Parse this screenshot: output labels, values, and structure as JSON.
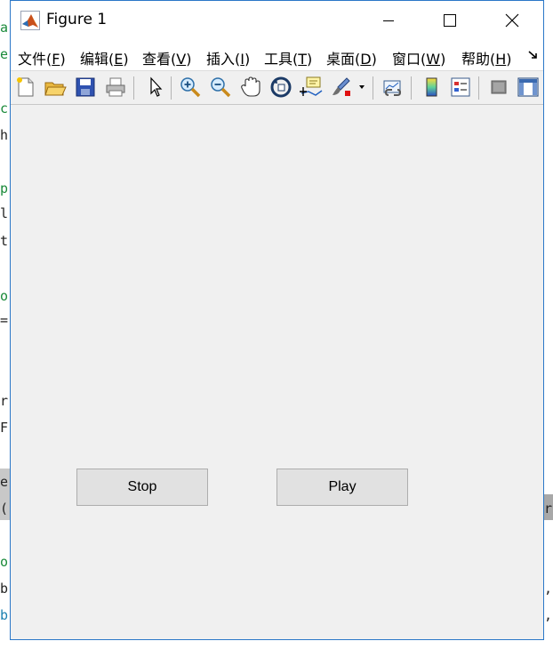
{
  "window": {
    "title": "Figure 1"
  },
  "menu": [
    {
      "text": "文件(",
      "key": "F",
      "tail": ")"
    },
    {
      "text": "编辑(",
      "key": "E",
      "tail": ")"
    },
    {
      "text": "查看(",
      "key": "V",
      "tail": ")"
    },
    {
      "text": "插入(",
      "key": "I",
      "tail": ")"
    },
    {
      "text": "工具(",
      "key": "T",
      "tail": ")"
    },
    {
      "text": "桌面(",
      "key": "D",
      "tail": ")"
    },
    {
      "text": "窗口(",
      "key": "W",
      "tail": ")"
    },
    {
      "text": "帮助(",
      "key": "H",
      "tail": ")"
    }
  ],
  "toolbar": {
    "icons": [
      "new-figure-icon",
      "open-file-icon",
      "save-icon",
      "print-icon",
      "select-arrow-icon",
      "zoom-in-icon",
      "zoom-out-icon",
      "pan-hand-icon",
      "rotate-3d-icon",
      "data-cursor-icon",
      "brush-icon",
      "link-plot-icon",
      "colorbar-icon",
      "legend-icon",
      "hide-plot-tools-icon",
      "show-plot-tools-icon"
    ]
  },
  "buttons": {
    "stop": "Stop",
    "play": "Play"
  },
  "background": {
    "left_chars": [
      "a",
      "e",
      "c",
      "h",
      "p",
      "l",
      "t",
      "o",
      "=",
      "r",
      "F",
      "e",
      "(",
      "o",
      "b",
      "b"
    ],
    "right_chars": [
      "r",
      ",",
      ","
    ]
  },
  "colors": {
    "window_border": "#2b77c8",
    "canvas": "#f0f0f0",
    "button_face": "#e1e1e1",
    "button_border": "#adadad"
  }
}
